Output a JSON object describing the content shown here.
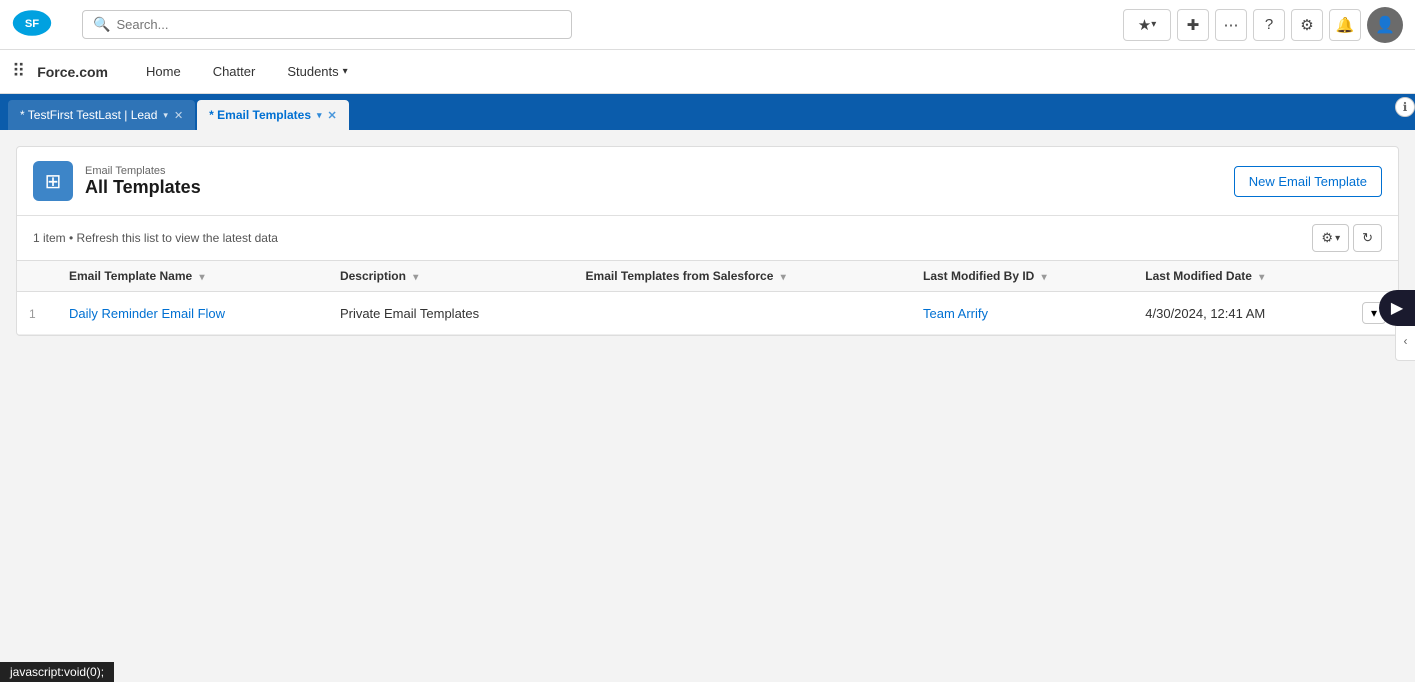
{
  "topNav": {
    "search_placeholder": "Search...",
    "brand": "Force.com",
    "nav_items": [
      {
        "label": "Home",
        "has_arrow": false
      },
      {
        "label": "Chatter",
        "has_arrow": false
      },
      {
        "label": "Students",
        "has_arrow": true
      }
    ],
    "icons": {
      "favorites": "★",
      "favorites_caret": "▾",
      "add": "+",
      "waffle": "⋯",
      "help": "?",
      "settings": "⚙",
      "notifications": "🔔"
    }
  },
  "tabs": [
    {
      "label": "* TestFirst TestLast | Lead",
      "active": false,
      "closeable": true
    },
    {
      "label": "* Email Templates",
      "active": true,
      "closeable": true
    }
  ],
  "page": {
    "breadcrumb": "Email Templates",
    "title": "All Templates",
    "new_button_label": "New Email Template",
    "list_info": "1 item • Refresh this list to view the latest data",
    "columns": [
      {
        "label": "Email Template Name",
        "sortable": true
      },
      {
        "label": "Description",
        "sortable": true
      },
      {
        "label": "Email Templates from Salesforce",
        "sortable": true
      },
      {
        "label": "Last Modified By ID",
        "sortable": true
      },
      {
        "label": "Last Modified Date",
        "sortable": true
      }
    ],
    "rows": [
      {
        "num": "1",
        "name": "Daily Reminder Email Flow",
        "description": "Private Email Templates",
        "from_salesforce": "",
        "last_modified_by": "Team Arrify",
        "last_modified_date": "4/30/2024, 12:41 AM"
      }
    ]
  },
  "statusBar": {
    "text": "javascript:void(0);"
  }
}
